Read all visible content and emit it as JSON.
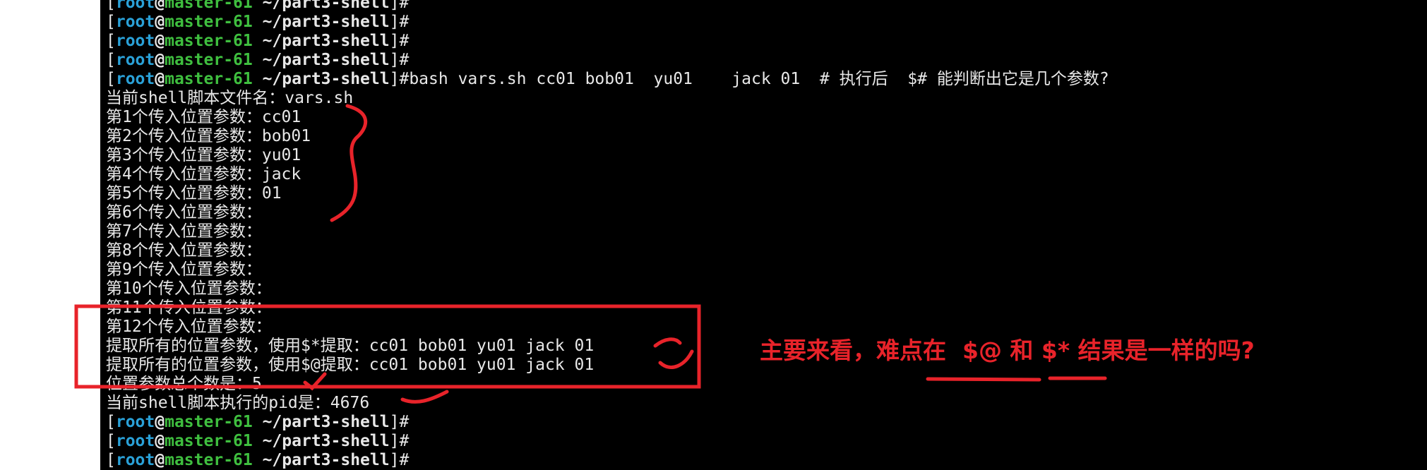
{
  "prompt": {
    "user": "root",
    "at": "@",
    "host": "master-61",
    "path": " ~/part3-shell",
    "open_bracket": "[",
    "close_bracket": "]",
    "symbol": "#"
  },
  "command": "bash vars.sh cc01 bob01  yu01    jack 01  # 执行后  $# 能判断出它是几个参数?",
  "output": [
    "当前shell脚本文件名：vars.sh",
    "第1个传入位置参数：cc01",
    "第2个传入位置参数：bob01",
    "第3个传入位置参数：yu01",
    "第4个传入位置参数：jack",
    "第5个传入位置参数：01",
    "第6个传入位置参数：",
    "第7个传入位置参数：",
    "第8个传入位置参数：",
    "第9个传入位置参数：",
    "第10个传入位置参数：",
    "第11个传入位置参数：",
    "第12个传入位置参数：",
    "提取所有的位置参数，使用$*提取：cc01 bob01 yu01 jack 01",
    "提取所有的位置参数，使用$@提取：cc01 bob01 yu01 jack 01",
    "位置参数总个数是：5",
    "当前shell脚本执行的pid是：4676"
  ],
  "annotation": "主要来看，难点在  $@ 和 $* 结果是一样的吗?",
  "colors": {
    "terminal_bg": "#000000",
    "text": "#e8e8e8",
    "user": "#2aa1d8",
    "host": "#3fbf3f",
    "annotation": "#e8232a"
  }
}
